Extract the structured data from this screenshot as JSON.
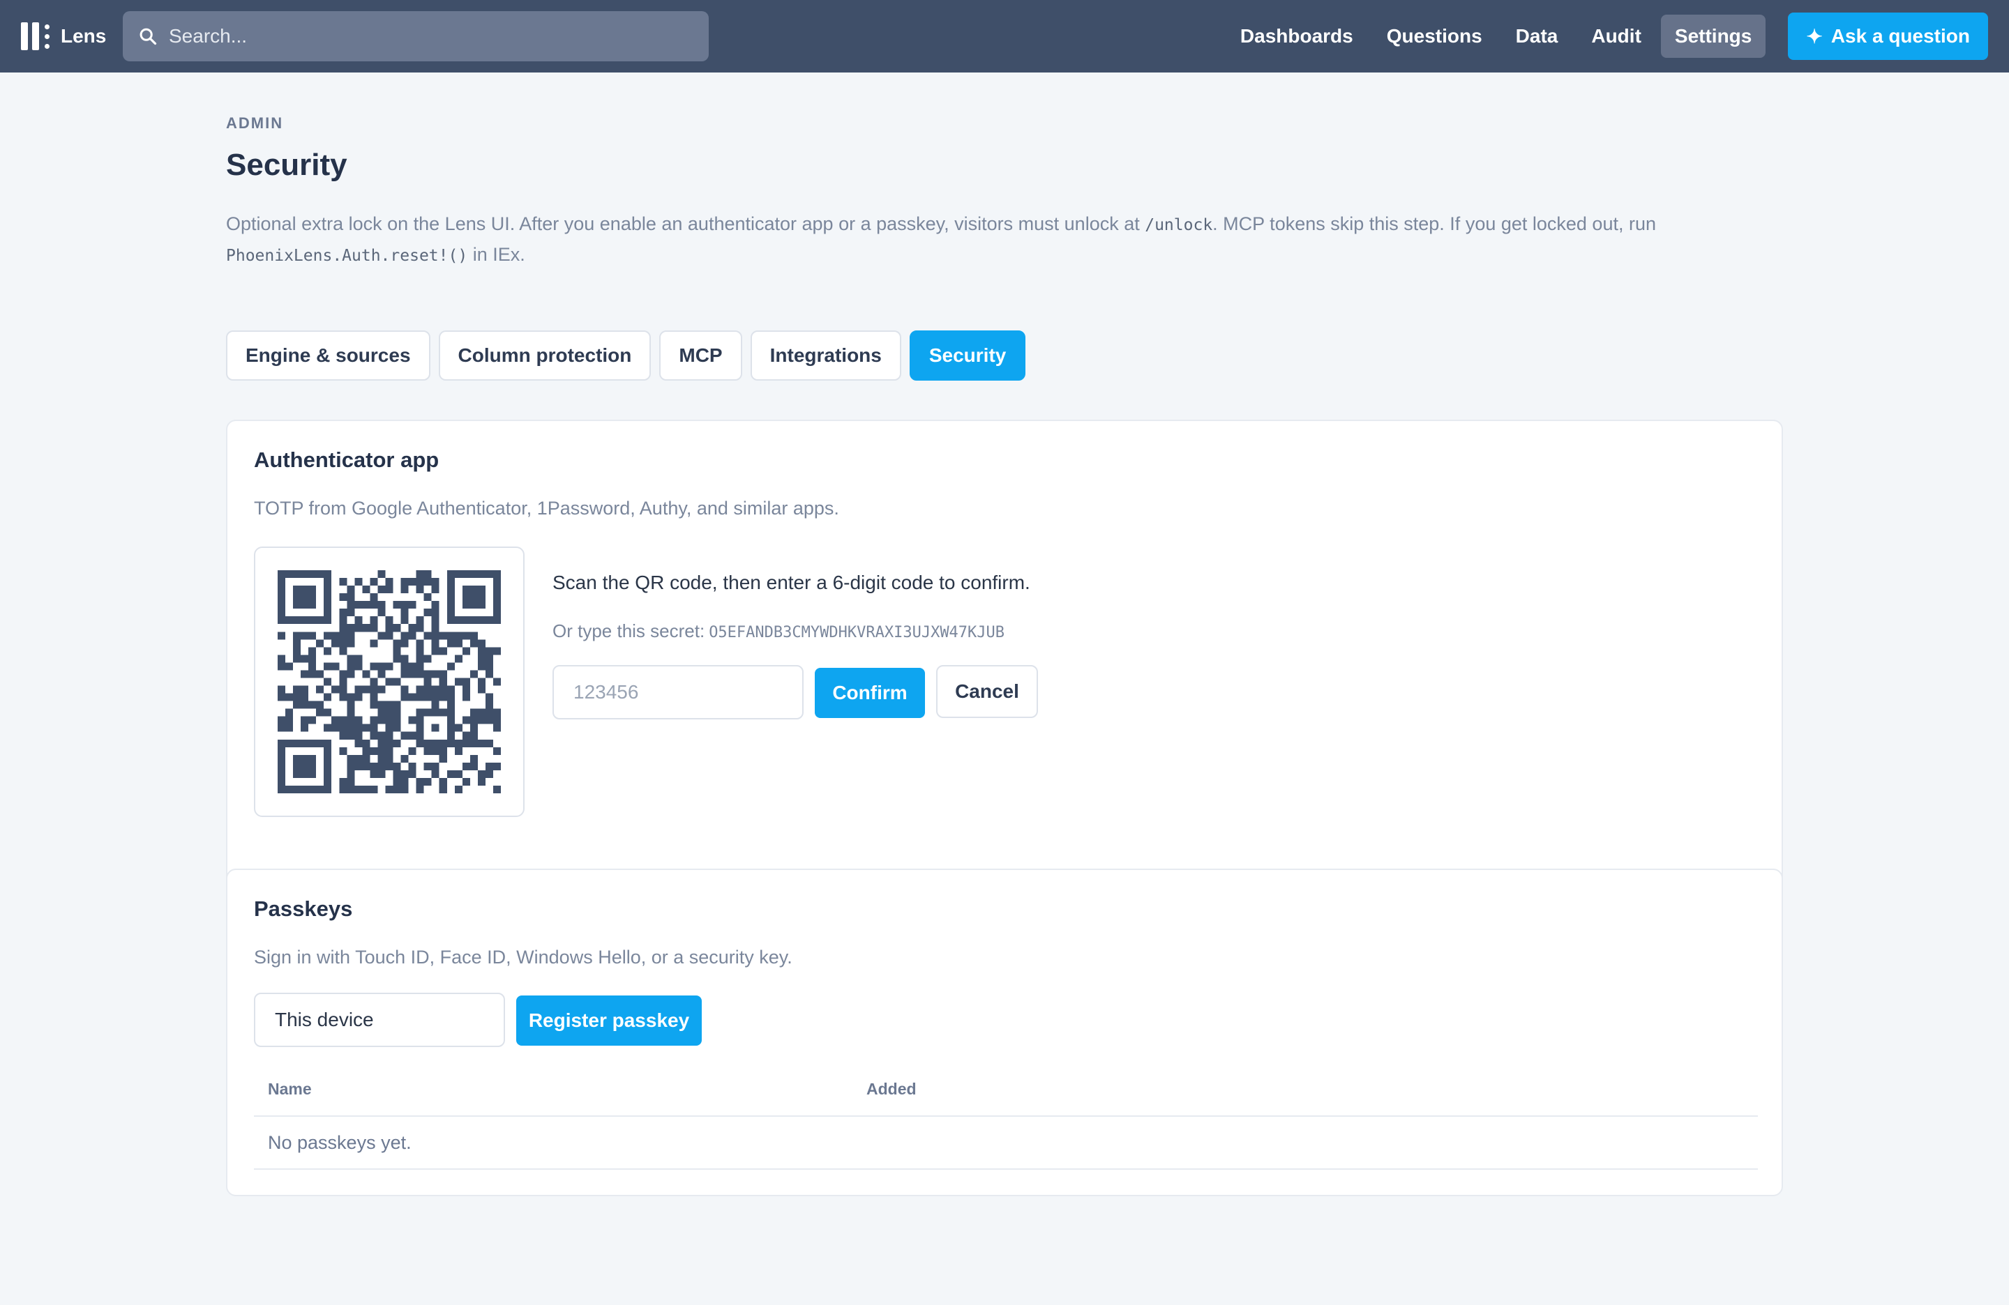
{
  "app": {
    "name": "Lens"
  },
  "search": {
    "placeholder": "Search..."
  },
  "nav": {
    "items": [
      {
        "label": "Dashboards",
        "active": false
      },
      {
        "label": "Questions",
        "active": false
      },
      {
        "label": "Data",
        "active": false
      },
      {
        "label": "Audit",
        "active": false
      },
      {
        "label": "Settings",
        "active": true
      }
    ],
    "ask_label": "Ask a question"
  },
  "page": {
    "eyebrow": "ADMIN",
    "title": "Security",
    "description": {
      "part1": "Optional extra lock on the Lens UI. After you enable an authenticator app or a passkey, visitors must unlock at ",
      "code1": "/unlock",
      "part2": ". MCP tokens skip this step. If you get locked out, run ",
      "code2": "PhoenixLens.Auth.reset!()",
      "part3": " in IEx."
    }
  },
  "tabs": [
    {
      "label": "Engine & sources",
      "active": false
    },
    {
      "label": "Column protection",
      "active": false
    },
    {
      "label": "MCP",
      "active": false
    },
    {
      "label": "Integrations",
      "active": false
    },
    {
      "label": "Security",
      "active": true
    }
  ],
  "authenticator": {
    "title": "Authenticator app",
    "subtitle": "TOTP from Google Authenticator, 1Password, Authy, and similar apps.",
    "instructions": "Scan the QR code, then enter a 6-digit code to confirm.",
    "secret_label": "Or type this secret:",
    "secret": "O5EFANDB3CMYWDHKVRAXI3UJXW47KJUB",
    "code_placeholder": "123456",
    "code_value": "",
    "confirm_label": "Confirm",
    "cancel_label": "Cancel"
  },
  "passkeys": {
    "title": "Passkeys",
    "subtitle": "Sign in with Touch ID, Face ID, Windows Hello, or a security key.",
    "device_name_value": "This device",
    "register_label": "Register passkey",
    "columns": [
      "Name",
      "Added"
    ],
    "empty_text": "No passkeys yet."
  },
  "colors": {
    "topbar": "#3f4f69",
    "accent": "#0ea5f0",
    "page_bg": "#f3f6f9",
    "qr": "#3f4f69"
  },
  "icons": {
    "search": "search-icon",
    "ask": "sparkle-icon",
    "logo": "lens-logo-icon"
  }
}
